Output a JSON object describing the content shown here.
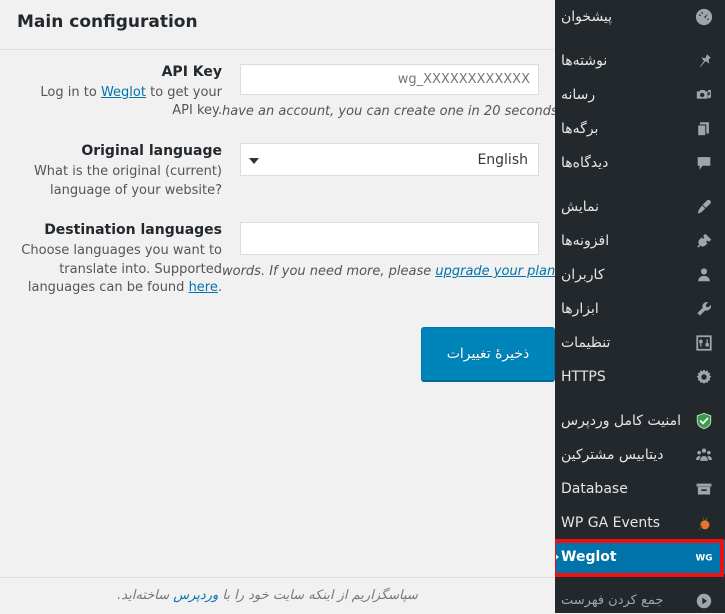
{
  "sidebar": {
    "items": [
      {
        "label": "پیشخوان",
        "icon": "dashboard-icon",
        "latin": false,
        "current": false,
        "sep_after": true
      },
      {
        "label": "نوشته‌ها",
        "icon": "pin-icon",
        "latin": false,
        "current": false,
        "sep_after": false
      },
      {
        "label": "رسانه",
        "icon": "media-icon",
        "latin": false,
        "current": false,
        "sep_after": false
      },
      {
        "label": "برگه‌ها",
        "icon": "pages-icon",
        "latin": false,
        "current": false,
        "sep_after": false
      },
      {
        "label": "دیدگاه‌ها",
        "icon": "comments-icon",
        "latin": false,
        "current": false,
        "sep_after": true
      },
      {
        "label": "نمایش",
        "icon": "appearance-icon",
        "latin": false,
        "current": false,
        "sep_after": false
      },
      {
        "label": "افزونه‌ها",
        "icon": "plugins-icon",
        "latin": false,
        "current": false,
        "sep_after": false
      },
      {
        "label": "کاربران",
        "icon": "users-icon",
        "latin": false,
        "current": false,
        "sep_after": false
      },
      {
        "label": "ابزارها",
        "icon": "tools-icon",
        "latin": false,
        "current": false,
        "sep_after": false
      },
      {
        "label": "تنظیمات",
        "icon": "settings-icon",
        "latin": false,
        "current": false,
        "sep_after": false
      },
      {
        "label": "HTTPS",
        "icon": "gear-icon",
        "latin": true,
        "current": false,
        "sep_after": true
      },
      {
        "label": "امنیت کامل وردپرس",
        "icon": "shield-icon",
        "latin": false,
        "current": false,
        "sep_after": false
      },
      {
        "label": "دیتابیس مشترکین",
        "icon": "subscribers-icon",
        "latin": false,
        "current": false,
        "sep_after": false
      },
      {
        "label": "Database",
        "icon": "database-icon",
        "latin": true,
        "current": false,
        "sep_after": false
      },
      {
        "label": "WP GA Events",
        "icon": "ga-events-icon",
        "latin": true,
        "current": false,
        "sep_after": false
      },
      {
        "label": "Weglot",
        "icon": "weglot-icon",
        "latin": true,
        "current": true,
        "sep_after": true
      },
      {
        "label": "جمع کردن فهرست",
        "icon": "collapse-icon",
        "latin": false,
        "current": false,
        "sep_after": false
      }
    ]
  },
  "page": {
    "title": "Main configuration"
  },
  "form": {
    "api_key": {
      "title": "API Key",
      "desc_prefix": "Log in to ",
      "desc_link": "Weglot",
      "desc_suffix": " to get your API key.",
      "placeholder": "wg_XXXXXXXXXXXX",
      "value": "",
      "note": "have an account, you can create one in 20 seconds"
    },
    "original_language": {
      "title": "Original language",
      "desc": "What is the original (current) language of your website?",
      "value": "English"
    },
    "destination_languages": {
      "title": "Destination languages",
      "desc_prefix": "Choose languages you want to translate into. Supported languages can be found ",
      "desc_link": "here",
      "desc_suffix": ".",
      "value": "",
      "note_prefix": "words. If you need more, please ",
      "note_link": "upgrade your plan"
    },
    "submit_label": "ذخیرهٔ تغییرات"
  },
  "footer": {
    "text_before": "سپاسگزاریم از اینکه سایت خود را با ",
    "link": "وردپرس",
    "text_after": " ساخته‌اید."
  },
  "colors": {
    "sidebar_bg": "#23282d",
    "current_item_bg": "#0073aa",
    "annotation": "#ee1111",
    "primary_button": "#0085ba",
    "link": "#0073aa",
    "page_bg": "#f1f1f1"
  }
}
